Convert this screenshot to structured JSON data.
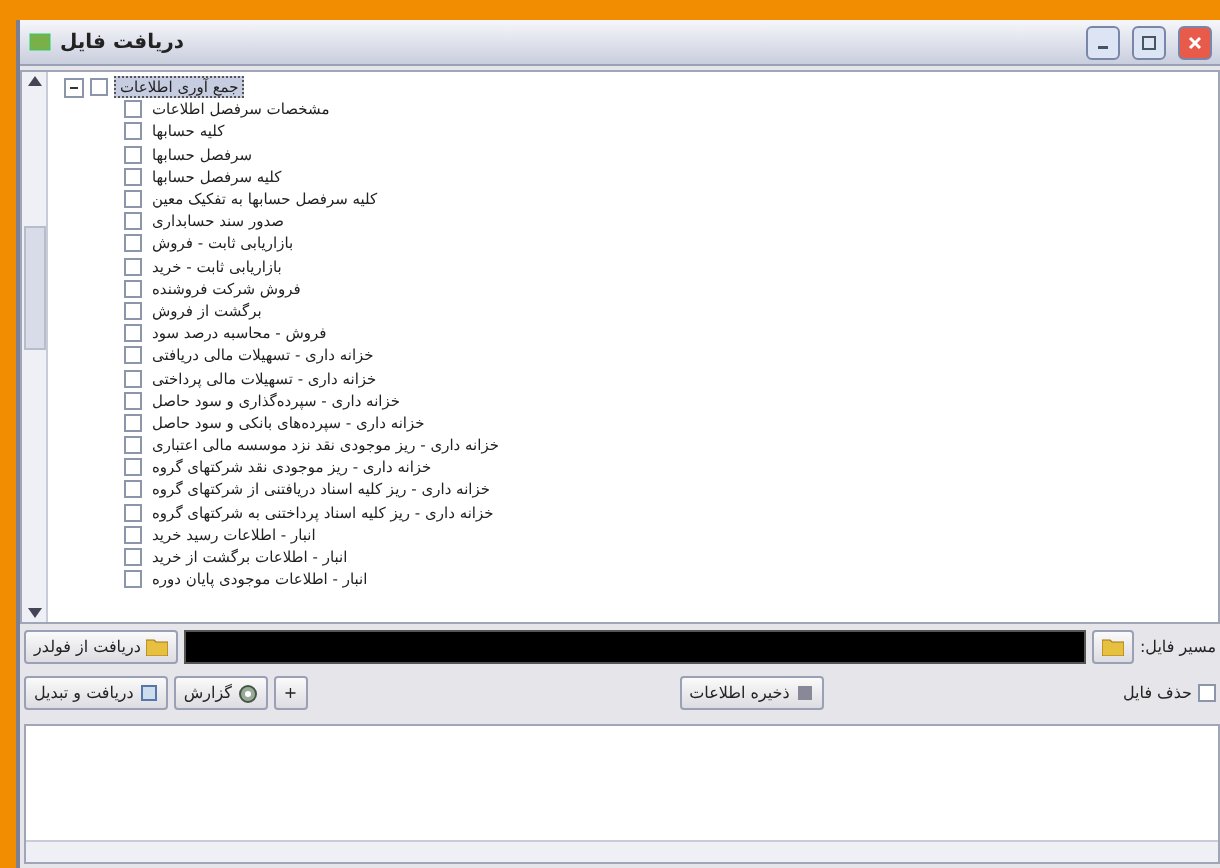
{
  "window": {
    "title": "دریافت فایل"
  },
  "tree": {
    "root": {
      "label": "جمع آوری اطلاعات",
      "selected": true,
      "expanded": true,
      "checked": false,
      "children": [
        {
          "label": "مشخصات سرفصل اطلاعات",
          "checked": false
        },
        {
          "label": "کلیه حسابها",
          "checked": false
        },
        {
          "label": "سرفصل حسابها",
          "checked": false
        },
        {
          "label": "کلیه سرفصل حسابها",
          "checked": false
        },
        {
          "label": "کلیه سرفصل حسابها به تفکیک معین",
          "checked": false
        },
        {
          "label": "صدور سند حسابداری",
          "checked": false
        },
        {
          "label": "بازاریابی ثابت - فروش",
          "checked": false
        },
        {
          "label": "بازاریابی ثابت - خرید",
          "checked": false
        },
        {
          "label": "فروش شرکت فروشنده",
          "checked": false
        },
        {
          "label": "برگشت از فروش",
          "checked": false
        },
        {
          "label": "فروش - محاسبه درصد سود",
          "checked": false
        },
        {
          "label": "خزانه داری - تسهیلات مالی دریافتی",
          "checked": false
        },
        {
          "label": "خزانه داری - تسهیلات مالی پرداختی",
          "checked": false
        },
        {
          "label": "خزانه داری - سپرده‌گذاری و سود حاصل",
          "checked": false
        },
        {
          "label": "خزانه داری - سپرده‌های بانکی و سود حاصل",
          "checked": false
        },
        {
          "label": "خزانه داری - ریز موجودی نقد نزد موسسه مالی اعتباری",
          "checked": false
        },
        {
          "label": "خزانه داری - ریز موجودی نقد شرکتهای گروه",
          "checked": false
        },
        {
          "label": "خزانه داری - ریز کلیه اسناد دریافتنی از شرکتهای گروه",
          "checked": false
        },
        {
          "label": "خزانه داری - ریز کلیه اسناد پرداختنی به شرکتهای گروه",
          "checked": false
        },
        {
          "label": "انبار - اطلاعات رسید خرید",
          "checked": false
        },
        {
          "label": "انبار - اطلاعات برگشت از خرید",
          "checked": false
        },
        {
          "label": "انبار - اطلاعات موجودی پایان دوره",
          "checked": false
        }
      ]
    }
  },
  "path_row": {
    "label": "مسیر فایل:",
    "browse_button": "دریافت از فولدر"
  },
  "action_row": {
    "delete_file": {
      "label": "حذف فایل",
      "checked": false
    },
    "save_button": "ذخیره اطلاعات",
    "expand_button": "+",
    "report_button": "گزارش",
    "convert_button": "دریافت و تبدیل"
  }
}
